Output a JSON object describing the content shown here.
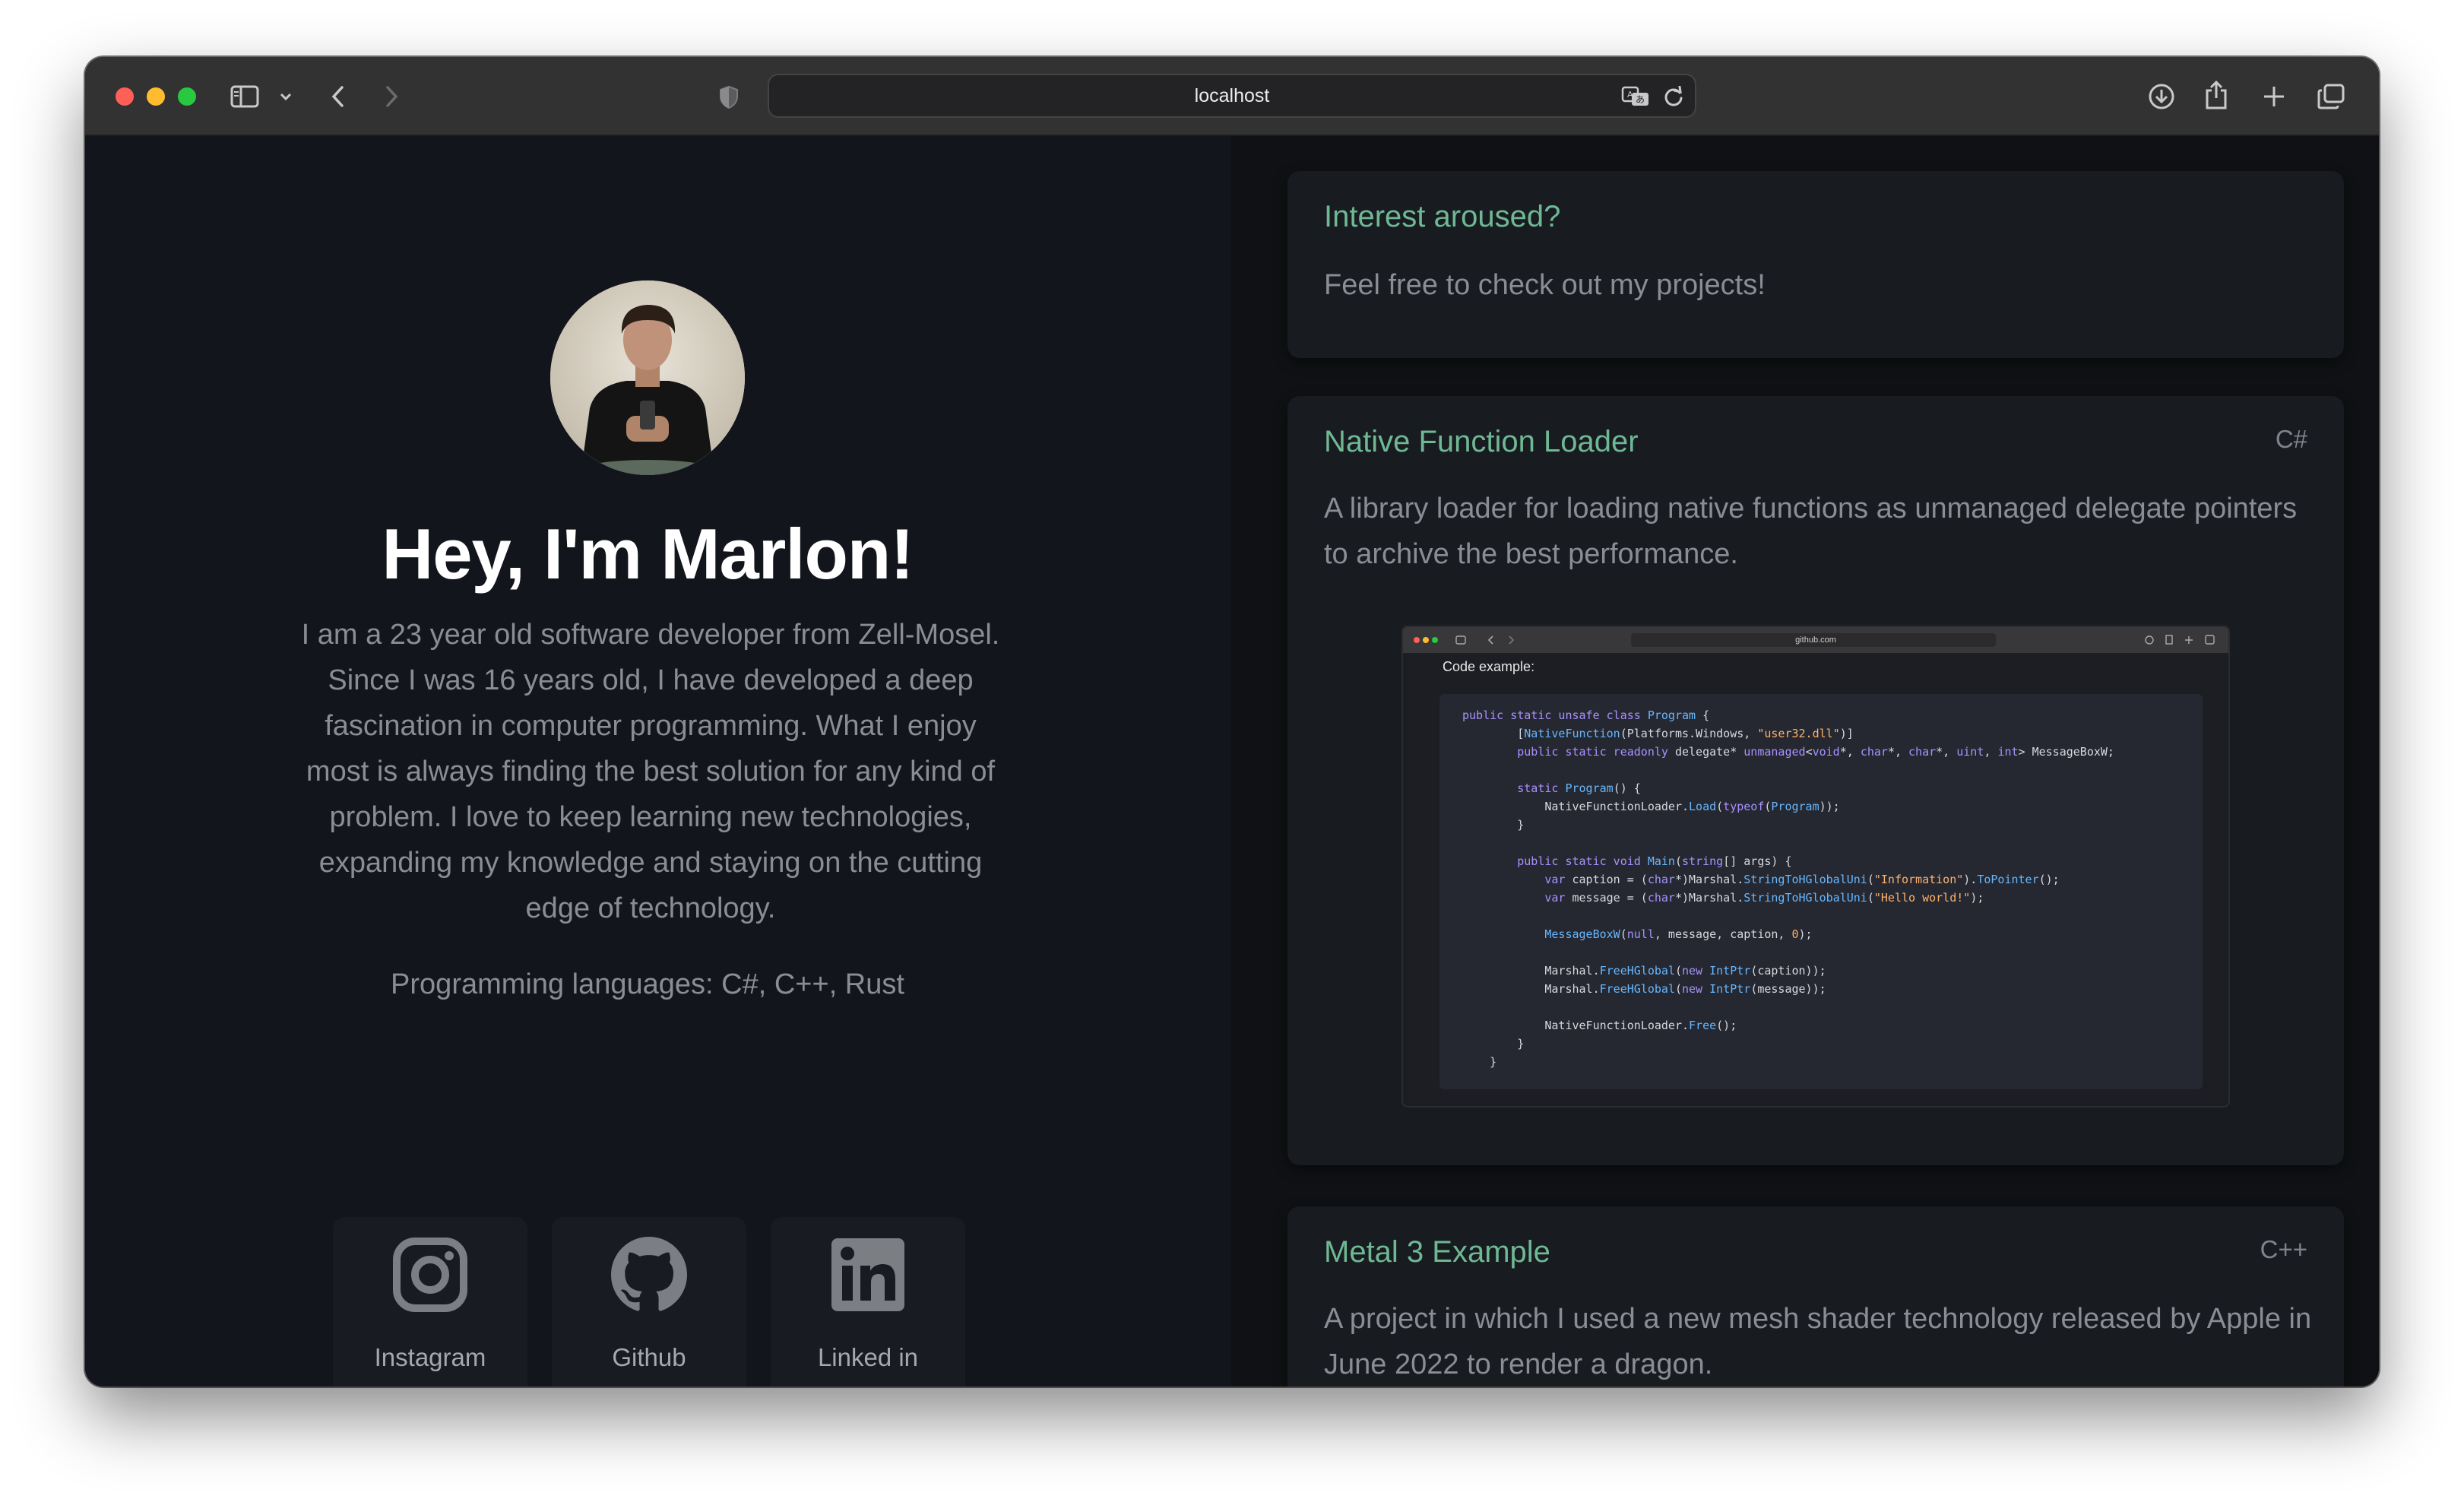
{
  "browser": {
    "url": "localhost",
    "icons": [
      "sidebar-icon",
      "chevron-down-icon",
      "back-icon",
      "forward-icon",
      "shield-icon",
      "translate-icon",
      "reload-icon",
      "download-icon",
      "share-icon",
      "new-tab-icon",
      "tabs-overview-icon"
    ]
  },
  "profile": {
    "title": "Hey, I'm Marlon!",
    "bio": "I am a 23 year old software developer from Zell-Mosel. Since I was 16 years old, I have developed a deep fascination in computer programming. What I enjoy most is always finding the best solution for any kind of problem. I love to keep learning new technologies, expanding my knowledge and staying on the cutting edge of technology.",
    "languages": "Programming languages: C#, C++, Rust"
  },
  "social": [
    {
      "label": "Instagram",
      "icon": "instagram-icon"
    },
    {
      "label": "Github",
      "icon": "github-icon"
    },
    {
      "label": "Linked in",
      "icon": "linkedin-icon"
    }
  ],
  "intro_card": {
    "title": "Interest aroused?",
    "text": "Feel free to check out my projects!"
  },
  "projects": [
    {
      "title": "Native Function Loader",
      "language": "C#",
      "description": "A library loader for loading native functions as unmanaged delegate pointers to archive the best performance.",
      "screenshot": {
        "url": "github.com",
        "label": "Code example:"
      }
    },
    {
      "title": "Metal 3 Example",
      "language": "C++",
      "description": "A project in which I used a new mesh shader technology released by Apple in June 2022 to render a dragon."
    }
  ],
  "colors": {
    "accent": "#6fb894",
    "left_background": "#12151b",
    "right_background": "#0f1114",
    "card_background": "#181b20"
  }
}
